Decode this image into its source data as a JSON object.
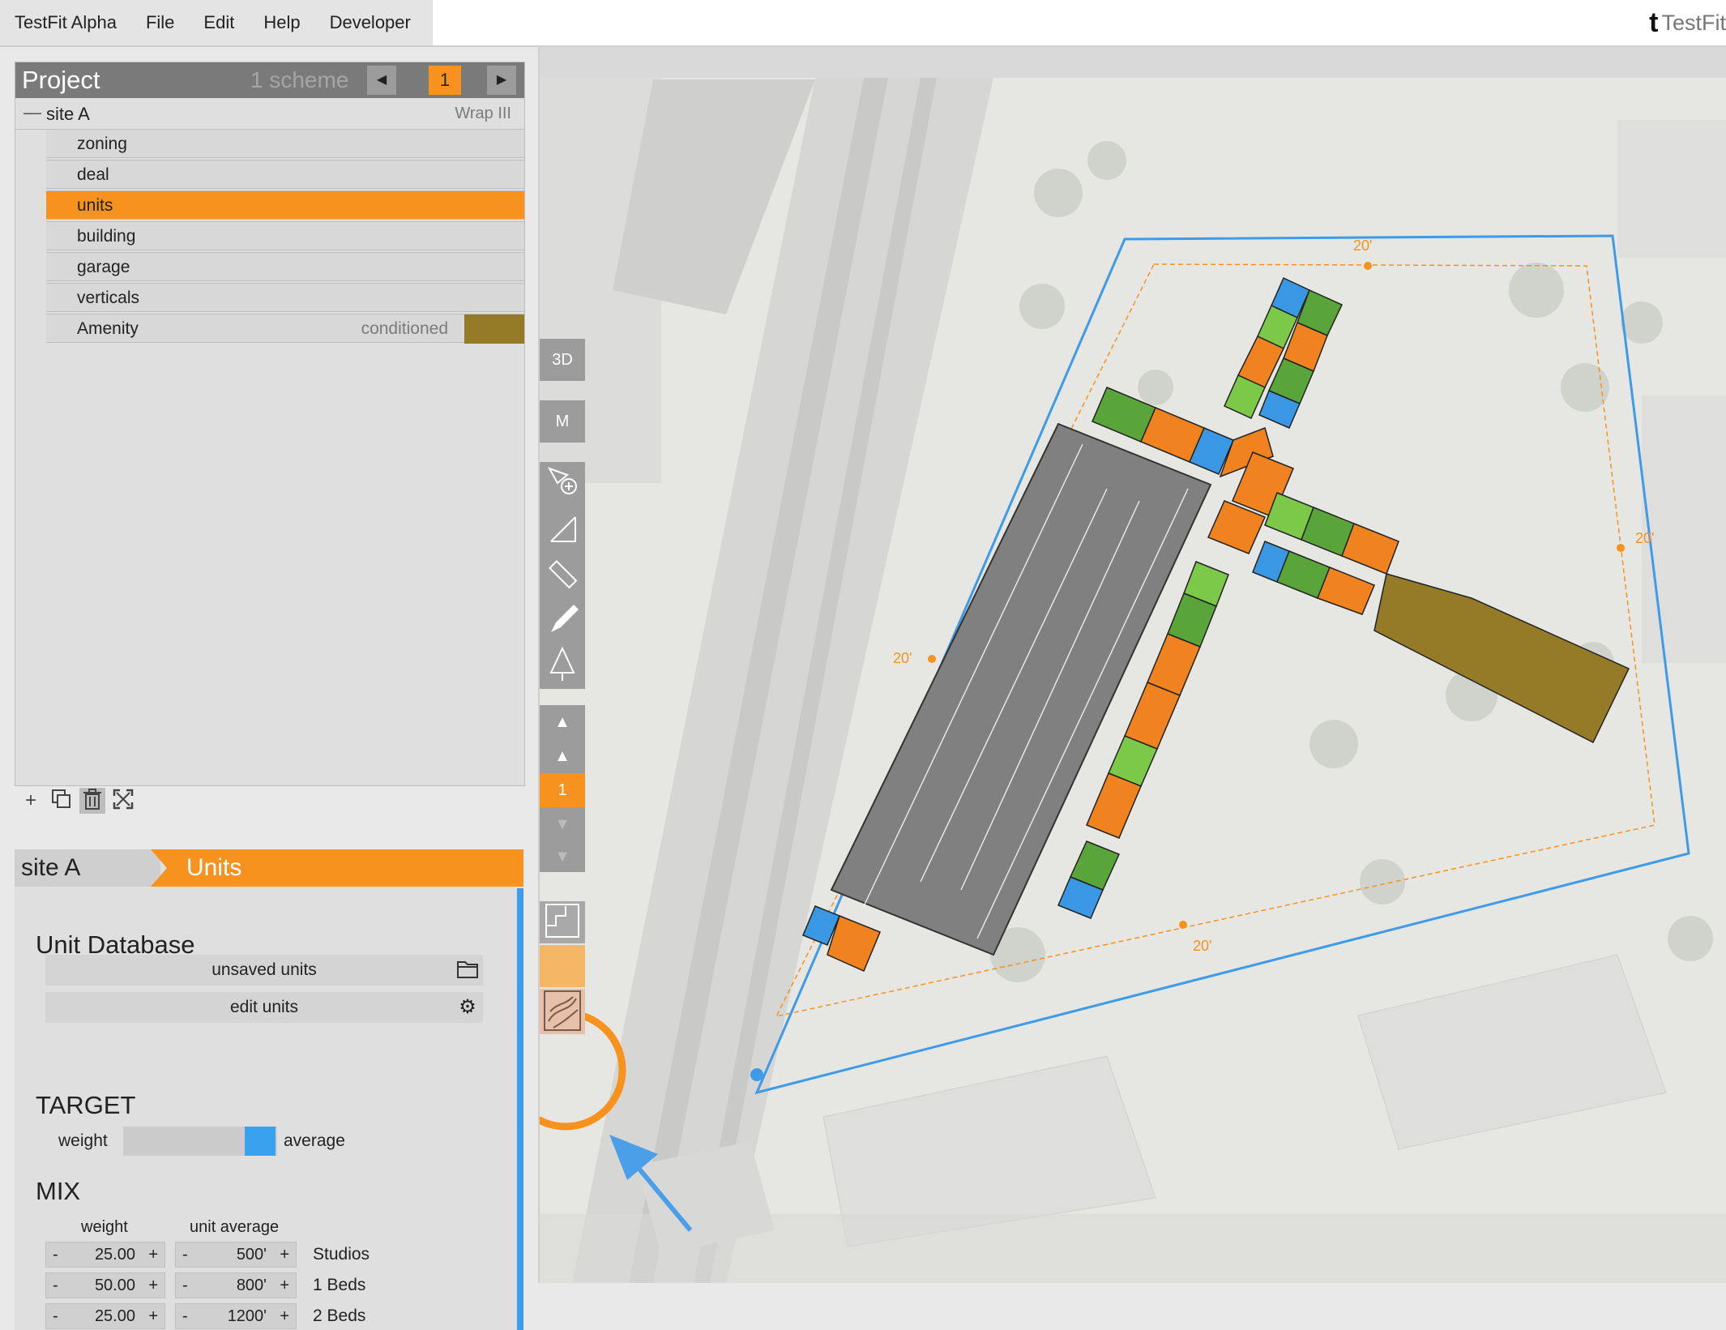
{
  "app": {
    "menu": [
      "TestFit Alpha",
      "File",
      "Edit",
      "Help",
      "Developer"
    ],
    "brand": "TestFit",
    "brand_logo": "t"
  },
  "project": {
    "title": "Project",
    "scheme_count": "1 scheme",
    "scheme_number": "1",
    "site_name": "site A",
    "site_type": "Wrap III",
    "items": [
      {
        "label": "zoning"
      },
      {
        "label": "deal"
      },
      {
        "label": "units",
        "active": true
      },
      {
        "label": "building"
      },
      {
        "label": "garage"
      },
      {
        "label": "verticals"
      },
      {
        "label": "Amenity",
        "sub": "conditioned",
        "swatch": "#957a27"
      }
    ]
  },
  "panel": {
    "site_tab": "site A",
    "units_tab": "Units",
    "db_title": "Unit Database",
    "unsaved_units": "unsaved units",
    "edit_units": "edit units",
    "target_title": "TARGET",
    "target_weight": "weight",
    "target_average": "average",
    "mix_title": "MIX",
    "mix_head_weight": "weight",
    "mix_head_avg": "unit average",
    "mix": [
      {
        "weight": "25.00",
        "avg": "500'",
        "name": "Studios"
      },
      {
        "weight": "50.00",
        "avg": "800'",
        "name": "1 Beds"
      },
      {
        "weight": "25.00",
        "avg": "1200'",
        "name": "2 Beds"
      }
    ]
  },
  "toolbar": {
    "view_3d": "3D",
    "view_m": "M",
    "level": "1"
  },
  "map": {
    "setback_labels": [
      "20'",
      "20'",
      "20'",
      "20'"
    ]
  },
  "colors": {
    "accent": "#f7921e",
    "selection": "#3d9be9",
    "amenity": "#957a27",
    "unit_green": "#5aa53a",
    "unit_light_green": "#7cc94a",
    "unit_orange": "#f0831f",
    "unit_blue": "#3a97e4",
    "parking": "#808080"
  }
}
